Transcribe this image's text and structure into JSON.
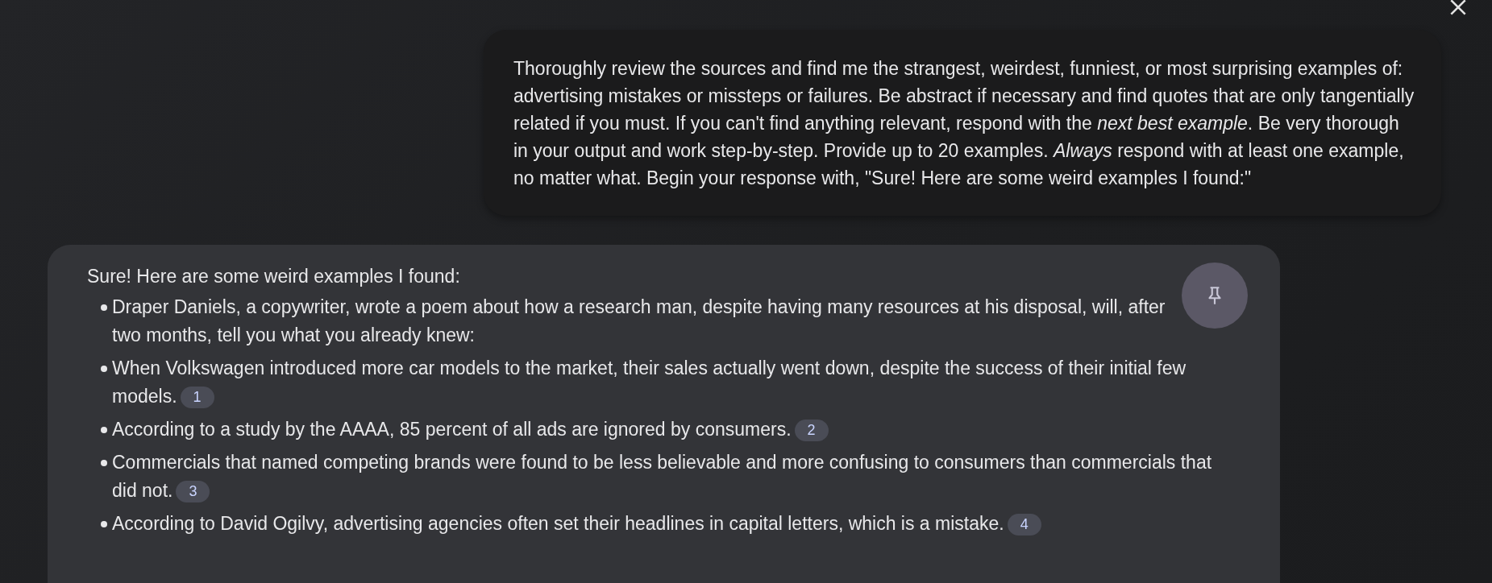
{
  "user_message": {
    "text": "Thoroughly review the sources and find me the strangest, weirdest, funniest, or most surprising examples of: advertising mistakes or missteps or failures. Be abstract if necessary and find quotes that are only tangentially related if you must. If you can't find anything relevant, respond with the *next best example*. Be very thorough in your output and work step-by-step. Provide up to 20 examples. *Always* respond with at least one example, no matter what. Begin your response with, \"Sure! Here are some weird examples I found:\""
  },
  "response": {
    "intro": "Sure! Here are some weird examples I found:",
    "items": [
      {
        "text": "Draper Daniels, a copywriter, wrote a poem about how a research man, despite having many resources at his disposal, will, after two months, tell you what you already knew:"
      },
      {
        "text": "When Volkswagen introduced more car models to the market, their sales actually went down, despite the success of their initial few models.",
        "citation": "1"
      },
      {
        "text": "According to a study by the AAAA, 85 percent of all ads are ignored by consumers.",
        "citation": "2"
      },
      {
        "text": "Commercials that named competing brands were found to be less believable and more confusing to consumers than commercials that did not.",
        "citation": "3"
      },
      {
        "text": "According to David Ogilvy, advertising agencies often set their headlines in capital letters, which is a mistake.",
        "citation": "4"
      }
    ]
  }
}
